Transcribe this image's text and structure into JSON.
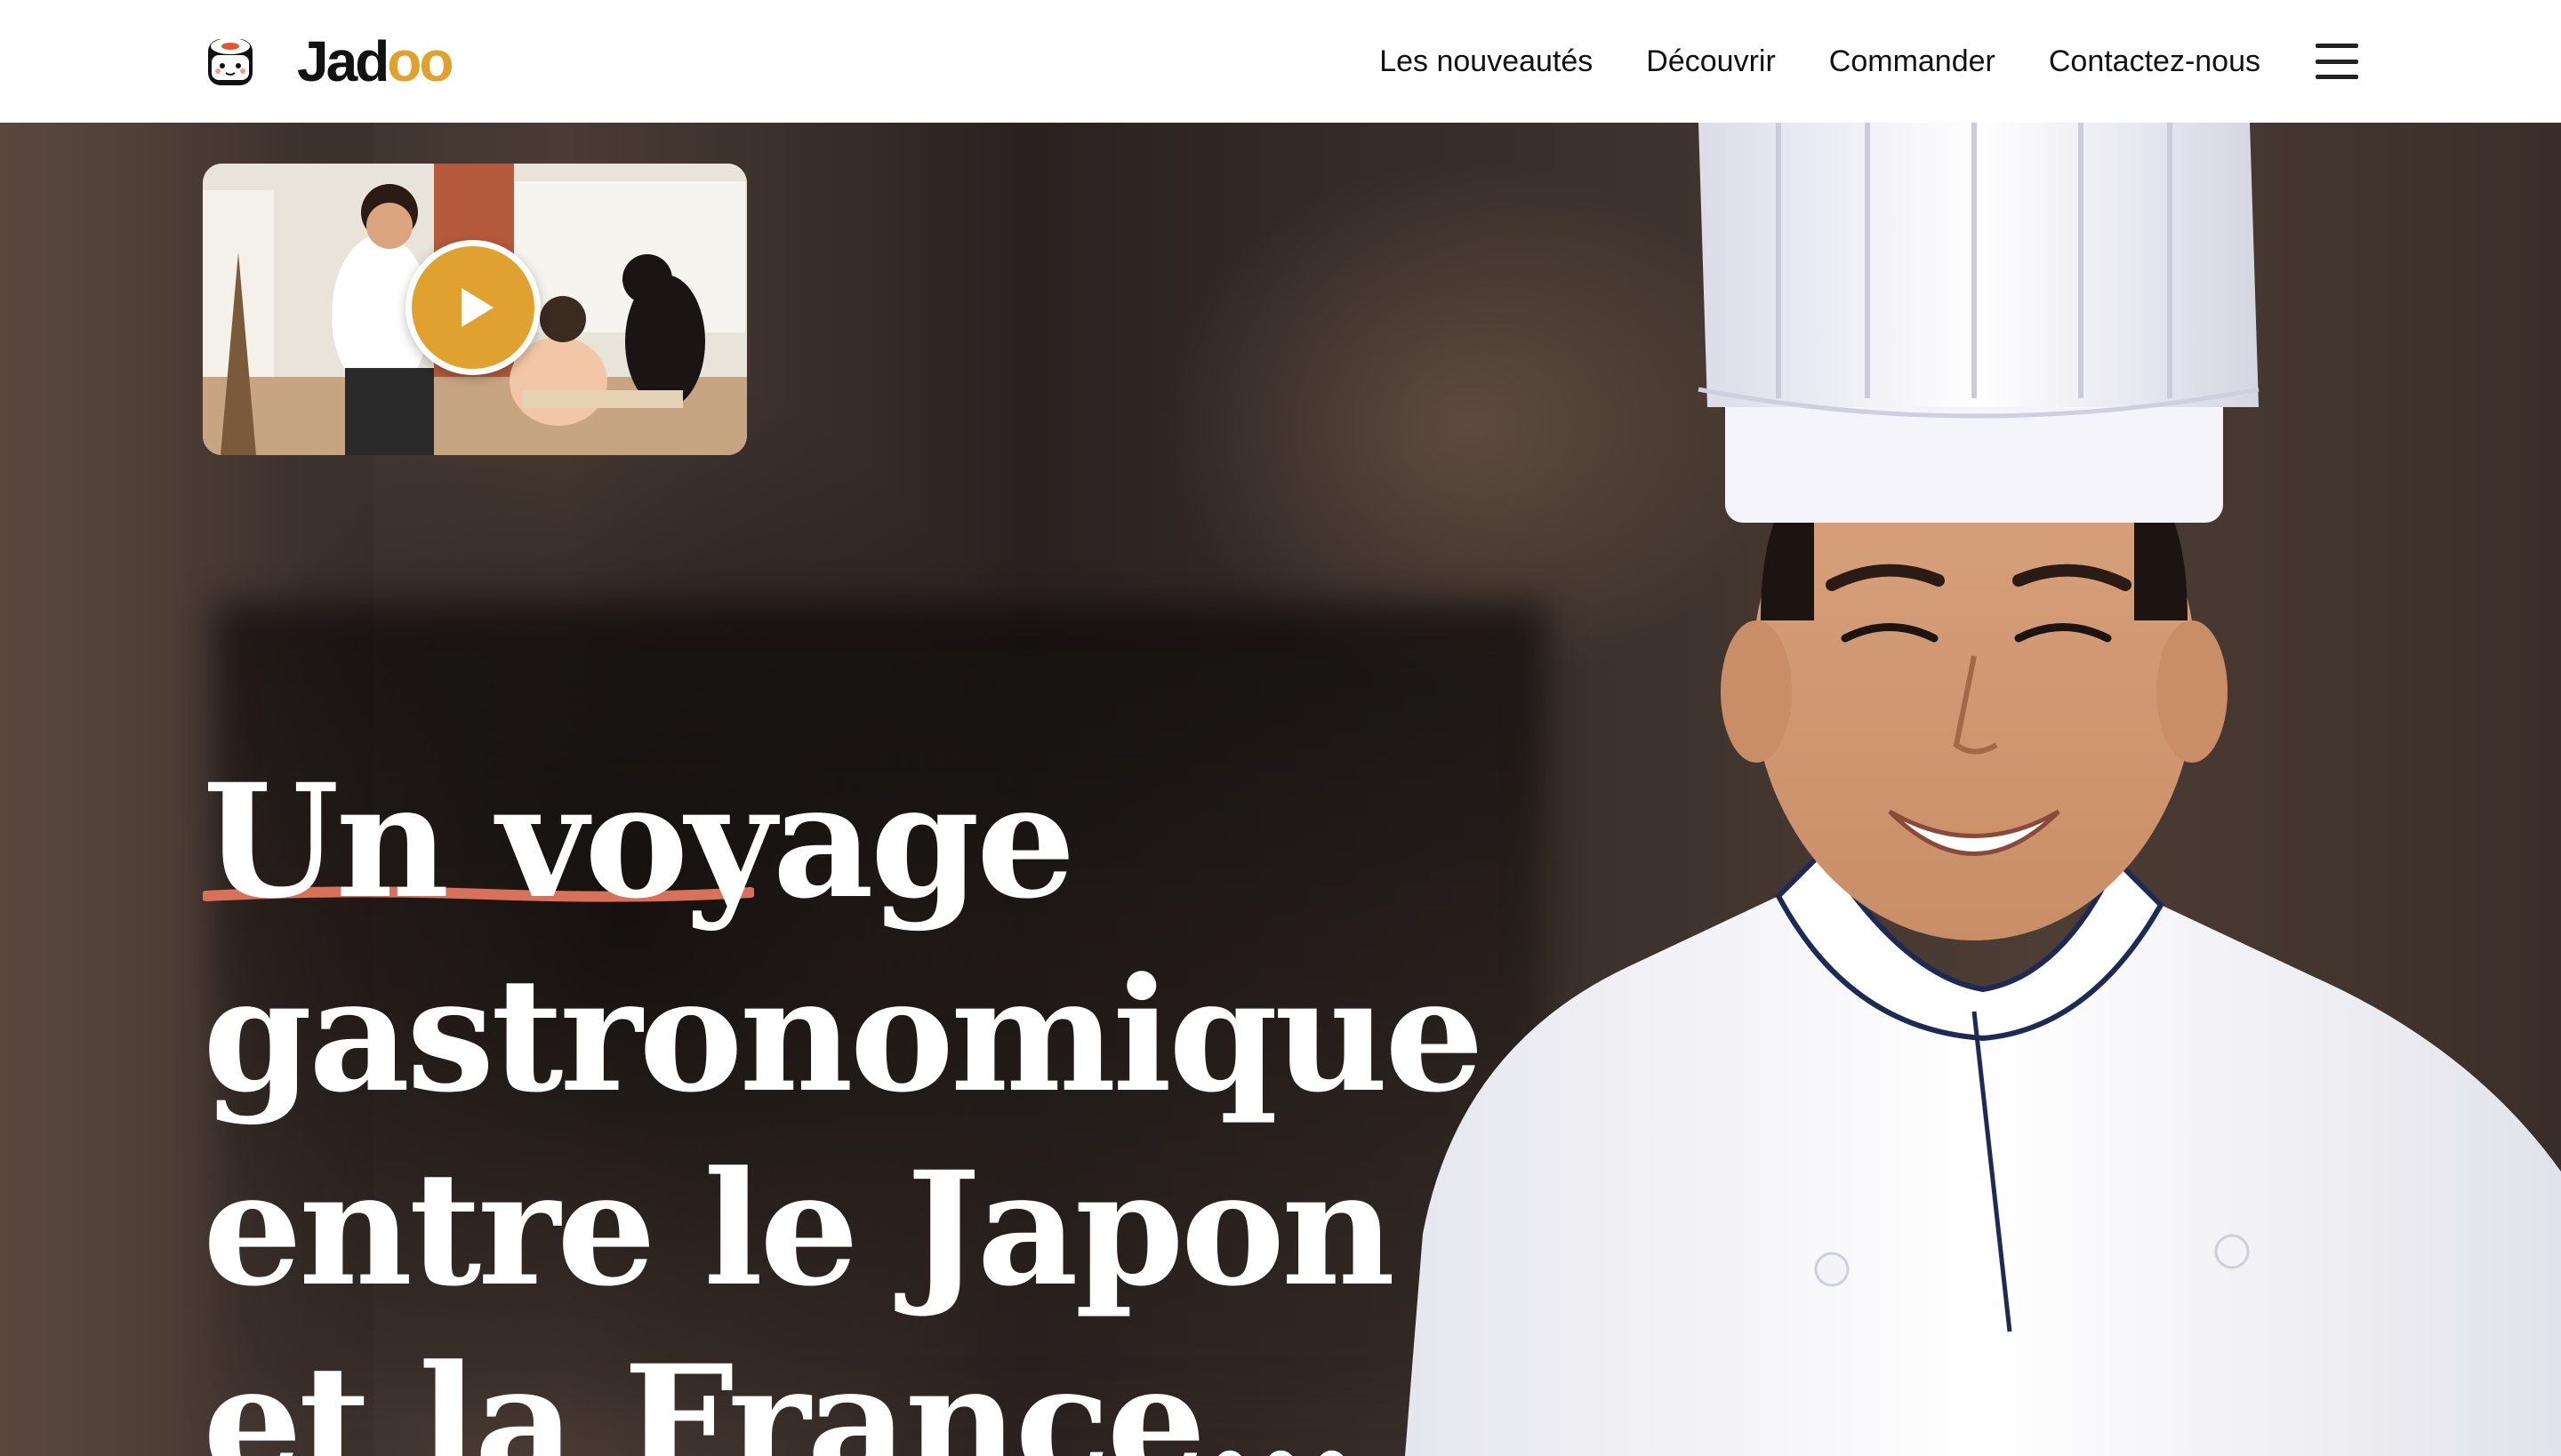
{
  "brand": {
    "name_prefix": "Jad",
    "name_highlight": "oo",
    "accent_color": "#e0a12e",
    "underline_color": "#d9715a"
  },
  "nav": {
    "links": [
      {
        "label": "Les nouveautés"
      },
      {
        "label": "Découvrir"
      },
      {
        "label": "Commander"
      },
      {
        "label": "Contactez-nous"
      }
    ],
    "menu_icon": "hamburger-icon"
  },
  "hero": {
    "headline_lines": [
      "Un voyage",
      "gastronomique",
      "entre le Japon",
      "et la France..."
    ],
    "video_icon": "play-icon"
  }
}
